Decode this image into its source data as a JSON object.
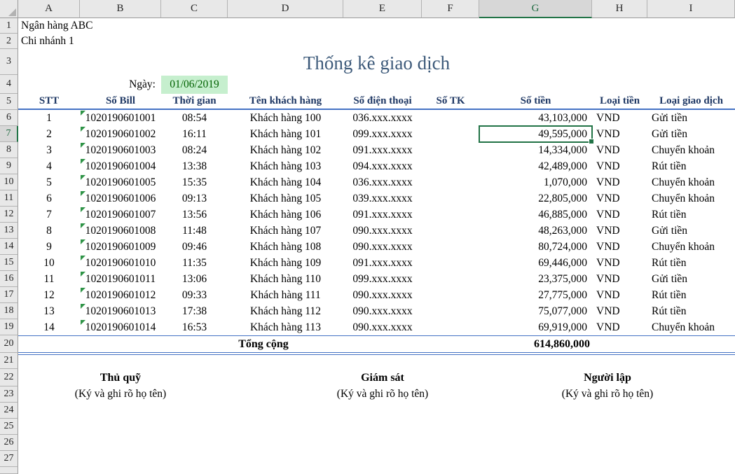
{
  "sheet": {
    "company": "Ngân hàng ABC",
    "branch": "Chi nhánh 1",
    "title": "Thống kê giao dịch",
    "date_label": "Ngày:",
    "date_value": "01/06/2019"
  },
  "grid": {
    "column_headers": [
      "A",
      "B",
      "C",
      "D",
      "E",
      "F",
      "G",
      "H",
      "I"
    ],
    "row_headers": [
      "1",
      "2",
      "3",
      "4",
      "5",
      "6",
      "7",
      "8",
      "9",
      "10",
      "11",
      "12",
      "13",
      "14",
      "15",
      "16",
      "17",
      "18",
      "19",
      "20",
      "21",
      "22",
      "23",
      "24",
      "25",
      "26",
      "27"
    ],
    "active_cell": {
      "column": "G",
      "row": "7",
      "value": "49,595,000"
    }
  },
  "table": {
    "headers": [
      "STT",
      "Số Bill",
      "Thời gian",
      "Tên khách hàng",
      "Số điện thoại",
      "Số TK",
      "Số tiền",
      "Loại tiền",
      "Loại giao dịch"
    ],
    "rows": [
      {
        "stt": "1",
        "bill": "1020190601001",
        "time": "08:54",
        "name": "Khách hàng 100",
        "phone": "036.xxx.xxxx",
        "account": "",
        "amount": "43,103,000",
        "currency": "VND",
        "type": "Gửi tiền"
      },
      {
        "stt": "2",
        "bill": "1020190601002",
        "time": "16:11",
        "name": "Khách hàng 101",
        "phone": "099.xxx.xxxx",
        "account": "",
        "amount": "49,595,000",
        "currency": "VND",
        "type": "Gửi tiền"
      },
      {
        "stt": "3",
        "bill": "1020190601003",
        "time": "08:24",
        "name": "Khách hàng 102",
        "phone": "091.xxx.xxxx",
        "account": "",
        "amount": "14,334,000",
        "currency": "VND",
        "type": "Chuyển khoản"
      },
      {
        "stt": "4",
        "bill": "1020190601004",
        "time": "13:38",
        "name": "Khách hàng 103",
        "phone": "094.xxx.xxxx",
        "account": "",
        "amount": "42,489,000",
        "currency": "VND",
        "type": "Rút tiền"
      },
      {
        "stt": "5",
        "bill": "1020190601005",
        "time": "15:35",
        "name": "Khách hàng 104",
        "phone": "036.xxx.xxxx",
        "account": "",
        "amount": "1,070,000",
        "currency": "VND",
        "type": "Chuyển khoản"
      },
      {
        "stt": "6",
        "bill": "1020190601006",
        "time": "09:13",
        "name": "Khách hàng 105",
        "phone": "039.xxx.xxxx",
        "account": "",
        "amount": "22,805,000",
        "currency": "VND",
        "type": "Chuyển khoản"
      },
      {
        "stt": "7",
        "bill": "1020190601007",
        "time": "13:56",
        "name": "Khách hàng 106",
        "phone": "091.xxx.xxxx",
        "account": "",
        "amount": "46,885,000",
        "currency": "VND",
        "type": "Rút tiền"
      },
      {
        "stt": "8",
        "bill": "1020190601008",
        "time": "11:48",
        "name": "Khách hàng 107",
        "phone": "090.xxx.xxxx",
        "account": "",
        "amount": "48,263,000",
        "currency": "VND",
        "type": "Gửi tiền"
      },
      {
        "stt": "9",
        "bill": "1020190601009",
        "time": "09:46",
        "name": "Khách hàng 108",
        "phone": "090.xxx.xxxx",
        "account": "",
        "amount": "80,724,000",
        "currency": "VND",
        "type": "Chuyển khoản"
      },
      {
        "stt": "10",
        "bill": "1020190601010",
        "time": "11:35",
        "name": "Khách hàng 109",
        "phone": "091.xxx.xxxx",
        "account": "",
        "amount": "69,446,000",
        "currency": "VND",
        "type": "Rút tiền"
      },
      {
        "stt": "11",
        "bill": "1020190601011",
        "time": "13:06",
        "name": "Khách hàng 110",
        "phone": "099.xxx.xxxx",
        "account": "",
        "amount": "23,375,000",
        "currency": "VND",
        "type": "Gửi tiền"
      },
      {
        "stt": "12",
        "bill": "1020190601012",
        "time": "09:33",
        "name": "Khách hàng 111",
        "phone": "090.xxx.xxxx",
        "account": "",
        "amount": "27,775,000",
        "currency": "VND",
        "type": "Rút tiền"
      },
      {
        "stt": "13",
        "bill": "1020190601013",
        "time": "17:38",
        "name": "Khách hàng 112",
        "phone": "090.xxx.xxxx",
        "account": "",
        "amount": "75,077,000",
        "currency": "VND",
        "type": "Rút tiền"
      },
      {
        "stt": "14",
        "bill": "1020190601014",
        "time": "16:53",
        "name": "Khách hàng 113",
        "phone": "090.xxx.xxxx",
        "account": "",
        "amount": "69,919,000",
        "currency": "VND",
        "type": "Chuyển khoản"
      }
    ],
    "total_label": "Tổng cộng",
    "total_value": "614,860,000"
  },
  "signatures": [
    {
      "title": "Thủ quỹ",
      "note": "(Ký và ghi rõ họ tên)"
    },
    {
      "title": "Giám sát",
      "note": "(Ký và ghi rõ họ tên)"
    },
    {
      "title": "Người lập",
      "note": "(Ký và ghi rõ họ tên)"
    }
  ],
  "colors": {
    "accent_green": "#217346",
    "indicator_green": "#2f9447",
    "header_navy": "#1f3864",
    "rule_blue": "#4472c4",
    "date_fill": "#c6efce",
    "date_text": "#006100",
    "title_color": "#3d5a7a"
  }
}
